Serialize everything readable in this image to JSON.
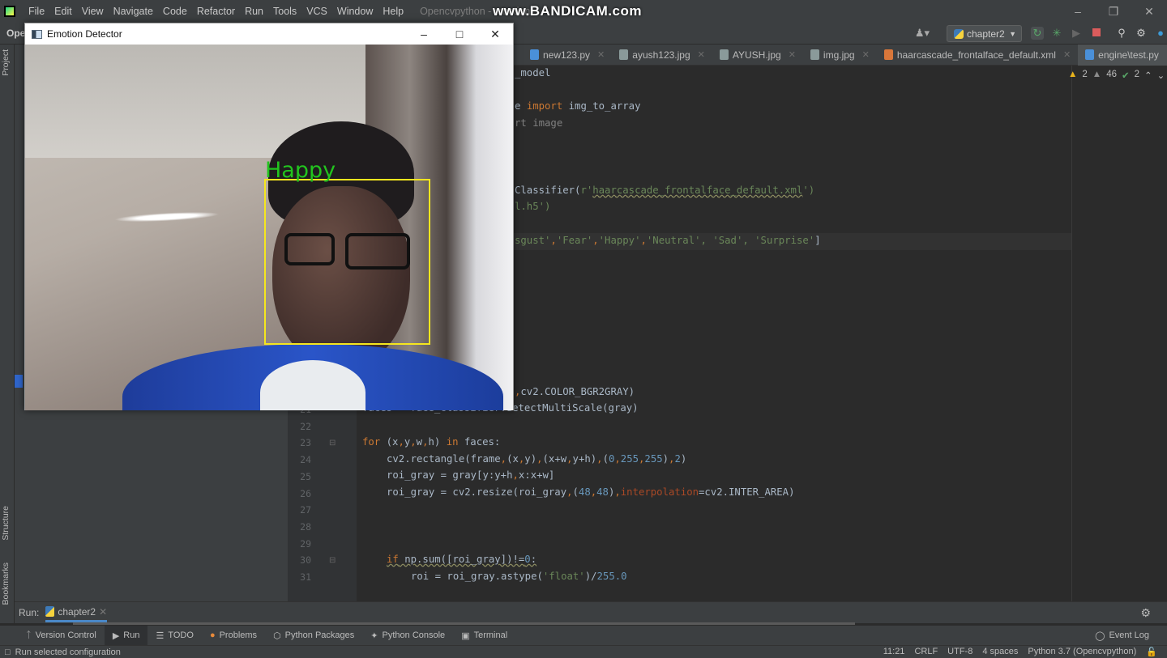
{
  "titlebar": {
    "menu": [
      "File",
      "Edit",
      "View",
      "Navigate",
      "Code",
      "Refactor",
      "Run",
      "Tools",
      "VCS",
      "Window",
      "Help"
    ],
    "app_title": "Opencvpython - emotion",
    "watermark": "www.BANDICAM.com"
  },
  "toolbar": {
    "project_label": "Ope",
    "run_config": "chapter2"
  },
  "side_tabs": {
    "project": "Project",
    "structure": "Structure",
    "bookmarks": "Bookmarks"
  },
  "tabs": [
    {
      "label": "new123.py",
      "icon": "python-file",
      "color": "#4a90d9"
    },
    {
      "label": "ayush123.jpg",
      "icon": "image-file",
      "color": "#9aa"
    },
    {
      "label": "AYUSH.jpg",
      "icon": "image-file",
      "color": "#9aa"
    },
    {
      "label": "img.jpg",
      "icon": "image-file",
      "color": "#9aa"
    },
    {
      "label": "haarcascade_frontalface_default.xml",
      "icon": "xml-file",
      "color": "#d9773a"
    },
    {
      "label": "engine\\test.py",
      "icon": "python-file",
      "color": "#4a90d9",
      "active": true
    }
  ],
  "inspections": {
    "warnings": "2",
    "weak_warnings": "46",
    "typos": "2"
  },
  "code": {
    "l1": "_model",
    "l3a": "e ",
    "l3b": "import",
    "l3c": " img_to_array",
    "l4": "rt image",
    "l8a": "Classifier(",
    "l8b": "r'",
    "l8c": "haarcascade_frontalface_default.xml",
    "l8d": "')",
    "l9": "l.h5')",
    "l11a": "sgust'",
    "l11b": ",",
    "l11c": "'Fear'",
    "l11d": ",",
    "l11e": "'Happy'",
    "l11f": ",",
    "l11g": "'Neutral', 'Sad', 'Surprise'",
    "l11h": "]",
    "l20a": ",",
    "l20b": "cv2.COLOR_BGR2GRAY)",
    "l21": "faces = face_classifier.detectMultiScale(gray)",
    "l23a": "for",
    "l23b": " (x",
    "l23c": ",",
    "l23d": "y",
    "l23e": ",",
    "l23f": "w",
    "l23g": ",",
    "l23h": "h) ",
    "l23i": "in",
    "l23j": " faces:",
    "l24a": "cv2.rectangle(frame",
    "l24b": ",",
    "l24c": "(x",
    "l24d": ",",
    "l24e": "y)",
    "l24f": ",",
    "l24g": "(x+w",
    "l24h": ",",
    "l24i": "y+h)",
    "l24j": ",",
    "l24k": "(",
    "l24l": "0",
    "l24m": ",",
    "l24n": "255",
    "l24o": ",",
    "l24p": "255",
    "l24q": ")",
    "l24r": ",",
    "l24s": "2",
    "l24t": ")",
    "l25a": "roi_gray = gray[y:y+h",
    "l25b": ",",
    "l25c": "x:x+w]",
    "l26a": "roi_gray = cv2.resize(roi_gray",
    "l26b": ",",
    "l26c": "(",
    "l26d": "48",
    "l26e": ",",
    "l26f": "48",
    "l26g": ")",
    "l26h": ",",
    "l26i": "interpolation",
    "l26j": "=cv2.INTER_AREA)",
    "l30a": "if",
    "l30b": " np.sum([roi_gray])!=",
    "l30c": "0",
    "l30d": ":",
    "l31a": "roi = roi_gray.astype(",
    "l31b": "'float'",
    "l31c": ")/",
    "l31d": "255.0"
  },
  "run": {
    "label": "Run:",
    "config": "chapter2"
  },
  "tool_tabs": [
    "Version Control",
    "Run",
    "TODO",
    "Problems",
    "Python Packages",
    "Python Console",
    "Terminal"
  ],
  "event_log": "Event Log",
  "status": {
    "message": "Run selected configuration",
    "position": "11:21",
    "line_sep": "CRLF",
    "encoding": "UTF-8",
    "indent": "4 spaces",
    "interpreter": "Python 3.7 (Opencvpython)"
  },
  "cv_window": {
    "title": "Emotion Detector",
    "label": "Happy",
    "label_color": "#22c41e",
    "box_color": "#f5e61e"
  }
}
